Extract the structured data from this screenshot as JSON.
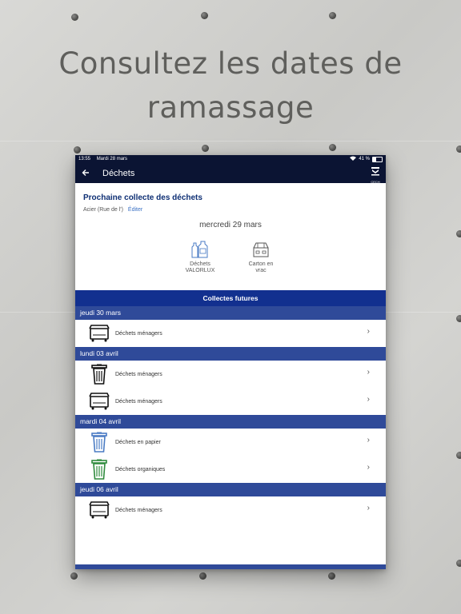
{
  "marketing": {
    "headline_line1": "Consultez les dates de",
    "headline_line2": "ramassage"
  },
  "statusbar": {
    "time": "13:55",
    "date": "Mardi 28 mars",
    "battery": "41 %"
  },
  "appbar": {
    "title": "Déchets",
    "logo_text": "CECH"
  },
  "next_collection": {
    "title": "Prochaine collecte des déchets",
    "address": "Acier (Rue de l')",
    "edit_label": "Éditer",
    "date": "mercredi 29 mars",
    "types": [
      {
        "label_line1": "Déchets",
        "label_line2": "VALORLUX",
        "icon": "bottles-icon"
      },
      {
        "label_line1": "Carton en",
        "label_line2": "vrac",
        "icon": "cardboard-box-icon"
      }
    ]
  },
  "futures": {
    "header": "Collectes futures",
    "days": [
      {
        "date": "jeudi 30 mars",
        "items": [
          {
            "label": "Déchets ménagers",
            "icon": "container-bin-icon",
            "color": "#111111"
          }
        ]
      },
      {
        "date": "lundi 03 avril",
        "items": [
          {
            "label": "Déchets ménagers",
            "icon": "trash-bin-icon",
            "color": "#111111"
          },
          {
            "label": "Déchets ménagers",
            "icon": "container-bin-icon",
            "color": "#111111"
          }
        ]
      },
      {
        "date": "mardi 04 avril",
        "items": [
          {
            "label": "Déchets en papier",
            "icon": "trash-bin-icon",
            "color": "#4a7bc4"
          },
          {
            "label": "Déchets organiques",
            "icon": "trash-bin-icon",
            "color": "#2e8a3c"
          }
        ]
      },
      {
        "date": "jeudi 06 avril",
        "items": [
          {
            "label": "Déchets ménagers",
            "icon": "container-bin-icon",
            "color": "#111111"
          }
        ]
      }
    ]
  },
  "colors": {
    "navy": "#0b1433",
    "header_blue": "#12308f",
    "day_blue": "#2f4a99",
    "link_blue": "#3b71c4"
  }
}
